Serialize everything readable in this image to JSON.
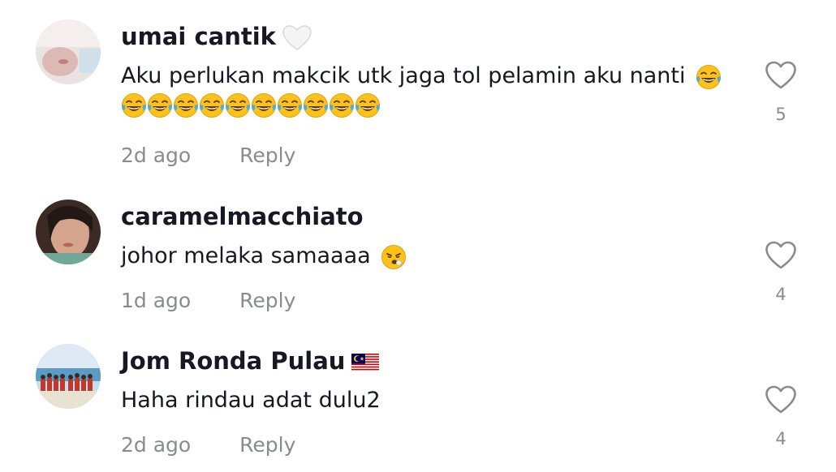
{
  "comments": [
    {
      "username": "umai cantik",
      "badge_icon": "white-heart-icon",
      "text": "Aku perlukan makcik utk jaga tol pelamin aku nanti",
      "trailing_emoji": "laughing-crying-emoji",
      "extra_emoji_count": 10,
      "time": "2d ago",
      "reply_label": "Reply",
      "like_count": "5"
    },
    {
      "username": "caramelmacchiato",
      "badge_icon": "",
      "text": "johor melaka samaaaa",
      "trailing_emoji": "tired-face-emoji",
      "time": "1d ago",
      "reply_label": "Reply",
      "like_count": "4"
    },
    {
      "username": "Jom Ronda Pulau",
      "badge_icon": "malaysia-flag-icon",
      "text": "Haha rindau adat dulu2",
      "time": "2d ago",
      "reply_label": "Reply",
      "like_count": "4"
    }
  ],
  "colors": {
    "primary_text": "#161823",
    "secondary_text": "#8a8b91",
    "heart_outline": "#8a8b91"
  }
}
